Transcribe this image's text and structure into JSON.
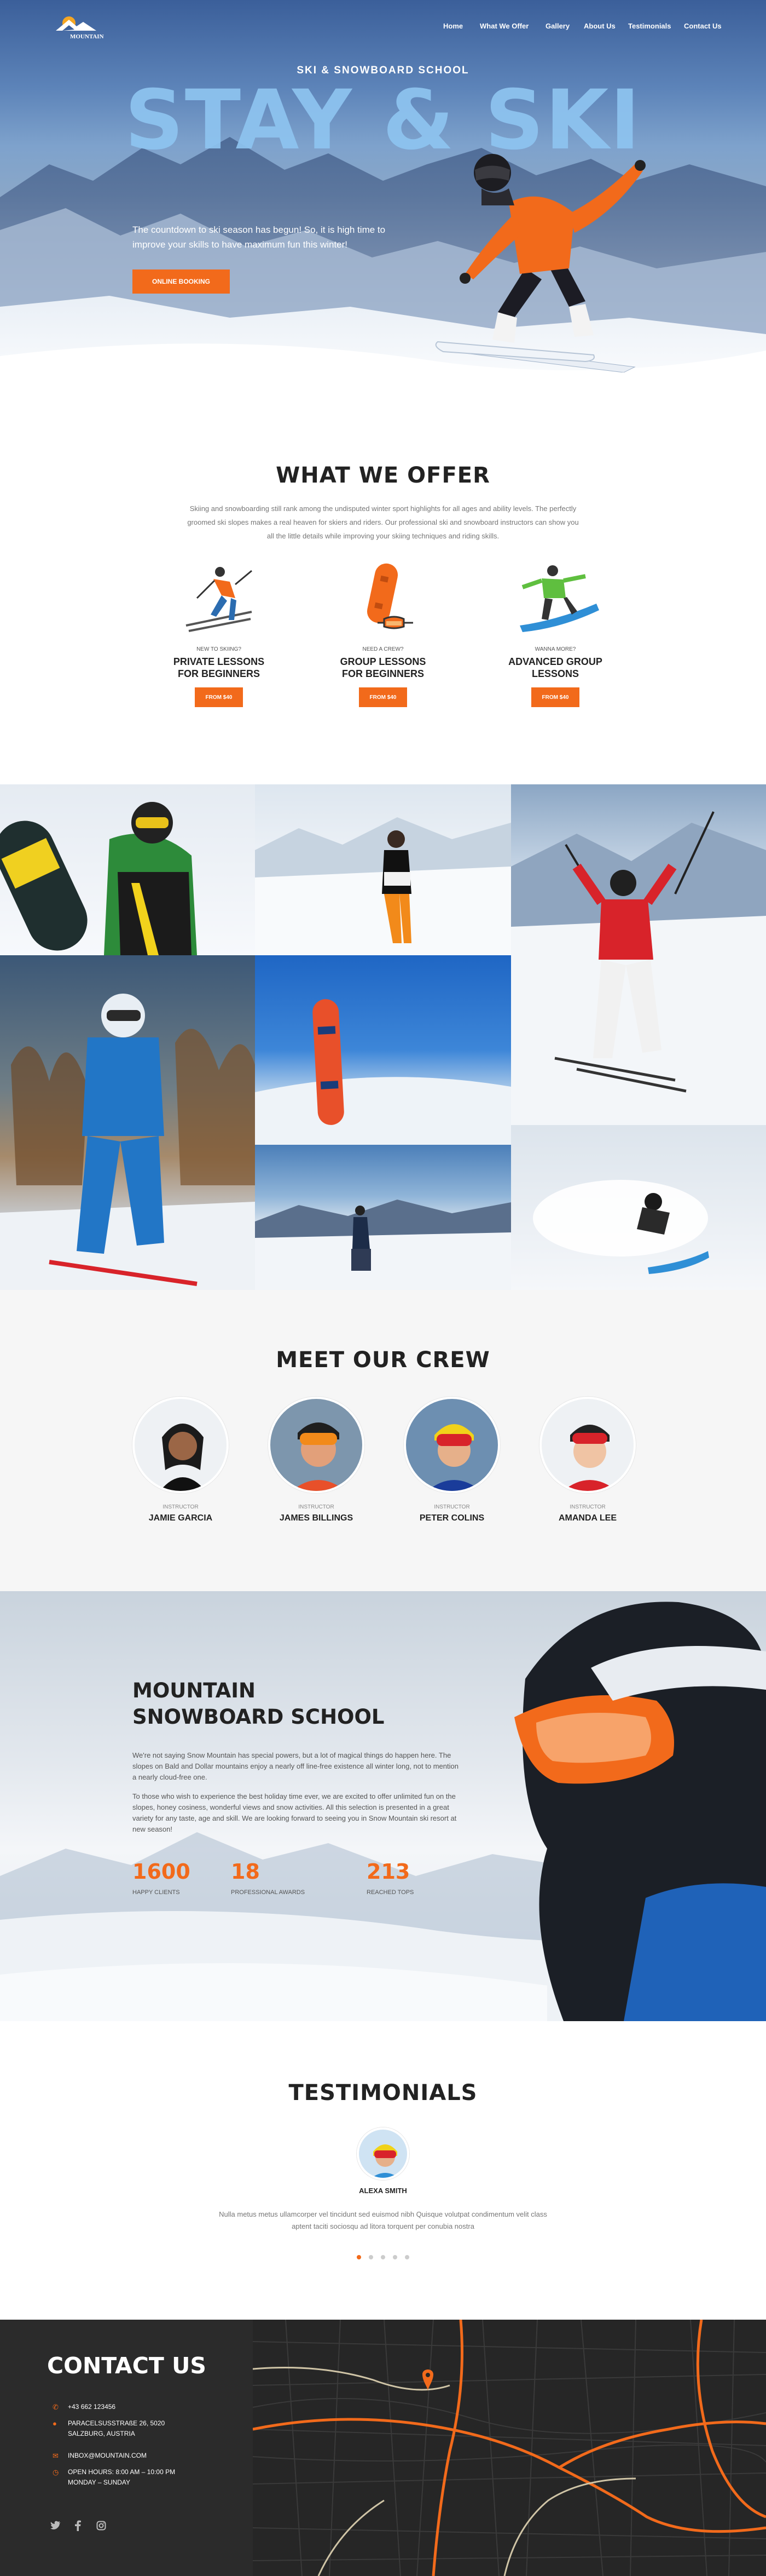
{
  "nav": {
    "logo_text": "MOUNTAIN",
    "links": [
      "Home",
      "What We Offer",
      "Gallery",
      "About Us",
      "Testimonials",
      "Contact Us"
    ]
  },
  "hero": {
    "subtitle": "SKI & SNOWBOARD SCHOOL",
    "title": "STAY & SKI",
    "text": "The countdown to ski season has begun! So, it is high time to improve your skills to have maximum fun this winter!",
    "button": "ONLINE BOOKING"
  },
  "offer": {
    "title": "WHAT WE OFFER",
    "intro": "Skiing and snowboarding still rank among the undisputed winter sport highlights for all ages and ability levels. The perfectly groomed ski slopes makes a real heaven for skiers and riders. Our professional ski and snowboard instructors can show you all the little details while improving your skiing techniques and riding skills.",
    "cards": [
      {
        "eyebrow": "NEW TO SKIING?",
        "title_line1": "PRIVATE LESSONS",
        "title_line2": "FOR BEGINNERS",
        "button": "FROM $40",
        "icon": "skier-icon"
      },
      {
        "eyebrow": "NEED A CREW?",
        "title_line1": "GROUP LESSONS",
        "title_line2": "FOR BEGINNERS",
        "button": "FROM $40",
        "icon": "snowboard-goggles-icon"
      },
      {
        "eyebrow": "WANNA MORE?",
        "title_line1": "ADVANCED GROUP",
        "title_line2": "LESSONS",
        "button": "FROM $40",
        "icon": "snowboarder-icon"
      }
    ]
  },
  "crew": {
    "title": "MEET OUR CREW",
    "members": [
      {
        "role": "INSTRUCTOR",
        "name": "JAMIE GARCIA"
      },
      {
        "role": "INSTRUCTOR",
        "name": "JAMES BILLINGS"
      },
      {
        "role": "INSTRUCTOR",
        "name": "PETER COLINS"
      },
      {
        "role": "INSTRUCTOR",
        "name": "AMANDA LEE"
      }
    ]
  },
  "school": {
    "title_line1": "MOUNTAIN",
    "title_line2": "SNOWBOARD SCHOOL",
    "p1": "We're not saying Snow Mountain has special powers, but a lot of magical things do happen here. The slopes on Bald and Dollar mountains enjoy a nearly off line-free existence all winter long, not to mention a nearly cloud-free one.",
    "p2": "To those who wish to experience the best holiday time ever, we are excited to offer unlimited fun on the slopes, honey cosiness, wonderful views and snow activities. All this selection is presented in a great variety for any taste, age and skill. We are looking forward to seeing you in Snow Mountain ski resort at new season!",
    "stats": [
      {
        "value": "1600",
        "label": "HAPPY CLIENTS"
      },
      {
        "value": "18",
        "label": "PROFESSIONAL AWARDS"
      },
      {
        "value": "213",
        "label": "REACHED TOPS"
      }
    ]
  },
  "testimonials": {
    "title": "TESTIMONIALS",
    "name": "ALEXA SMITH",
    "quote": "Nulla metus metus ullamcorper vel tincidunt sed euismod nibh Quisque volutpat condimentum velit class aptent taciti sociosqu ad litora torquent per conubia nostra",
    "slides": 5,
    "active_slide": 1
  },
  "contact": {
    "title": "CONTACT US",
    "phone": "+43 662 123456",
    "address_line1": "PARACELSUSSTRAßE 26, 5020",
    "address_line2": "SALZBURG, AUSTRIA",
    "email": "INBOX@MOUNTAIN.COM",
    "hours_line1": "OPEN HOURS: 8:00 AM – 10:00 PM",
    "hours_line2": "MONDAY – SUNDAY",
    "social": [
      "twitter-icon",
      "facebook-icon",
      "instagram-icon"
    ],
    "map_pin_color": "#f26a1b"
  },
  "colors": {
    "accent": "#f26a1b",
    "dark": "#2b2b2b"
  }
}
